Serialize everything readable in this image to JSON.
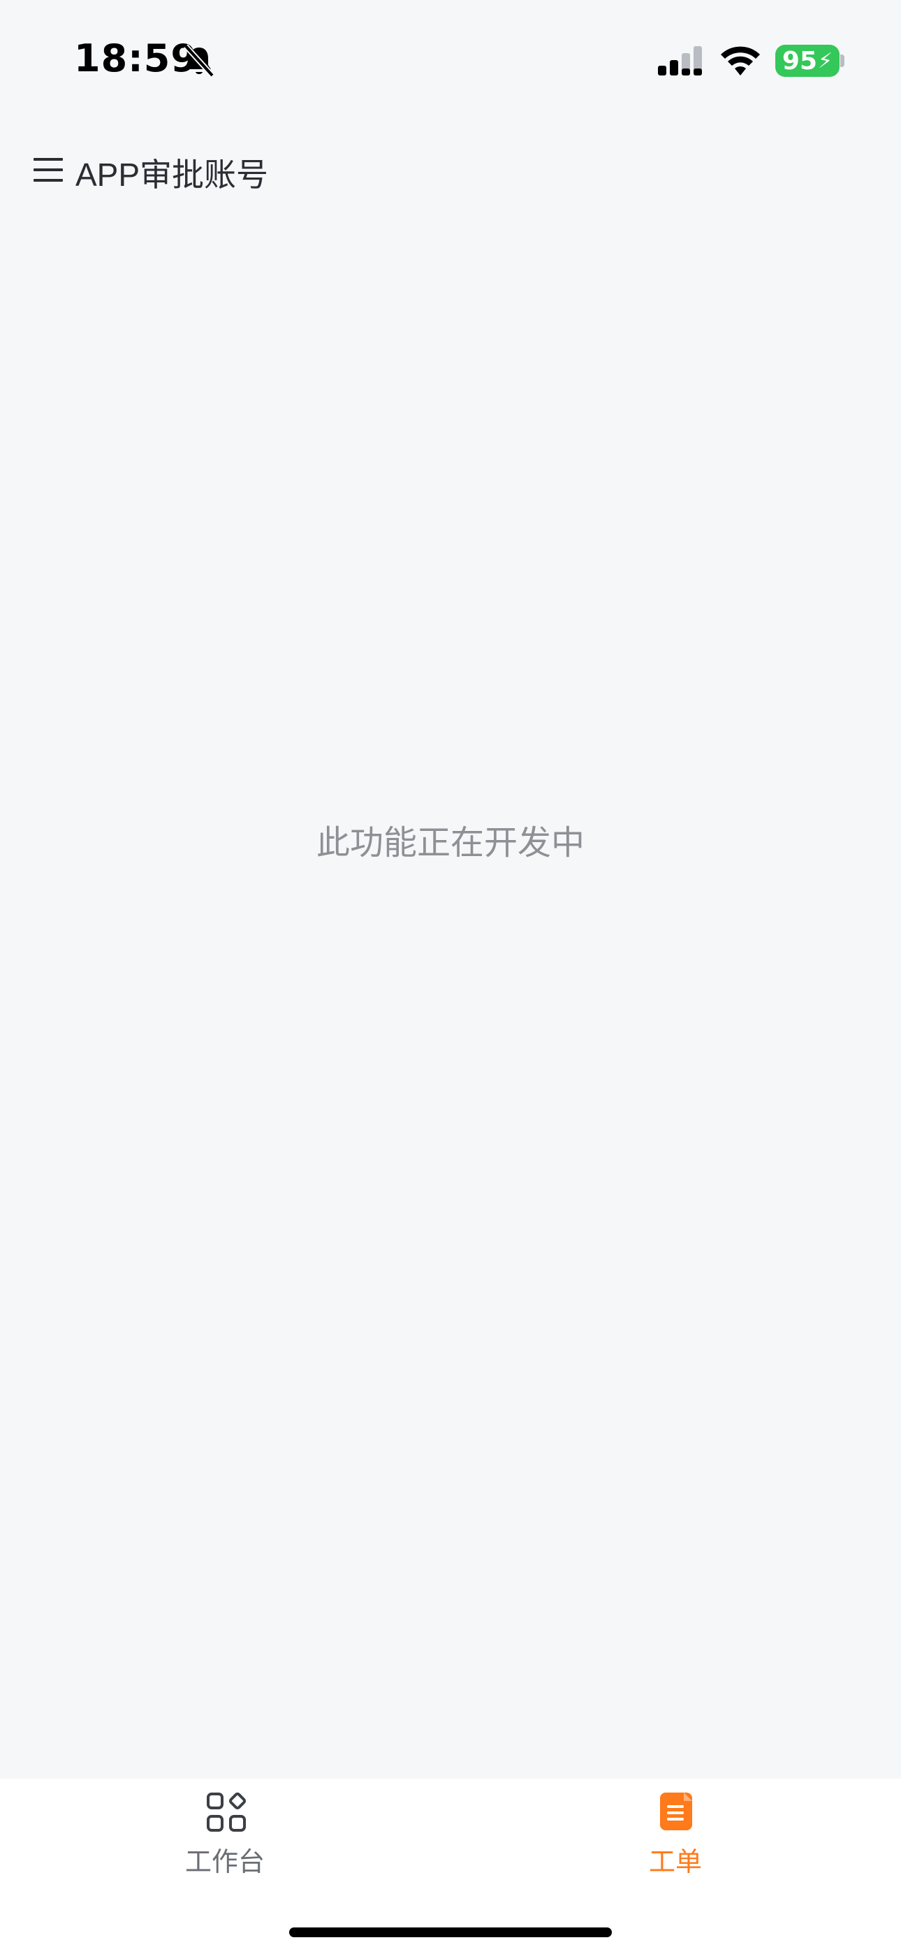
{
  "status_bar": {
    "time": "18:59",
    "battery_level": "95",
    "icons": [
      "bell-muted-icon",
      "cellular-signal-icon",
      "wifi-icon",
      "battery-charging-icon"
    ],
    "battery_color": "#34c759"
  },
  "header": {
    "title": "APP审批账号",
    "menu_icon": "menu-icon"
  },
  "main": {
    "message": "此功能正在开发中"
  },
  "tab_bar": {
    "items": [
      {
        "label": "工作台",
        "icon": "grid-icon",
        "active": false
      },
      {
        "label": "工单",
        "icon": "document-icon",
        "active": true
      }
    ],
    "active_color": "#ff7a1a",
    "inactive_color": "#6b6e75"
  }
}
